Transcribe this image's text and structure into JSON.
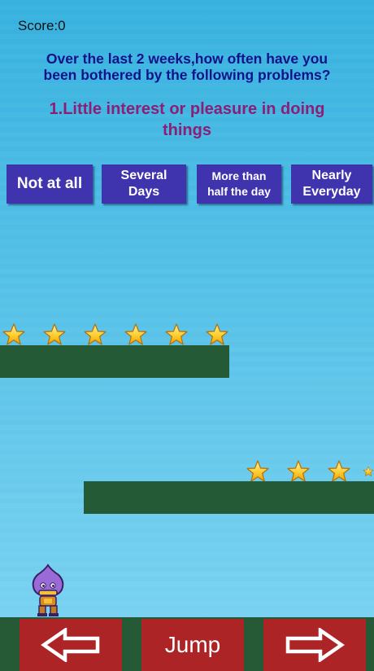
{
  "hud": {
    "score_label": "Score:0"
  },
  "question": {
    "line1": "Over the last 2 weeks,how often have you",
    "line2": "been bothered by the following problems?",
    "item_line1": "1.Little interest or pleasure in doing",
    "item_line2": "things"
  },
  "options": [
    {
      "line1": "Not at all",
      "line2": ""
    },
    {
      "line1": "Several",
      "line2": "Days"
    },
    {
      "line1": "More than",
      "line2": "half the day"
    },
    {
      "line1": "Nearly",
      "line2": "Everyday"
    }
  ],
  "controls": {
    "left_icon": "left-arrow-icon",
    "jump_label": "Jump",
    "right_icon": "right-arrow-icon"
  },
  "colors": {
    "sky": "#49bde6",
    "platform": "#255a36",
    "option_bg": "#3f34ad",
    "control_bg": "#ad2426",
    "question": "#13128a",
    "item": "#8b1f78"
  }
}
